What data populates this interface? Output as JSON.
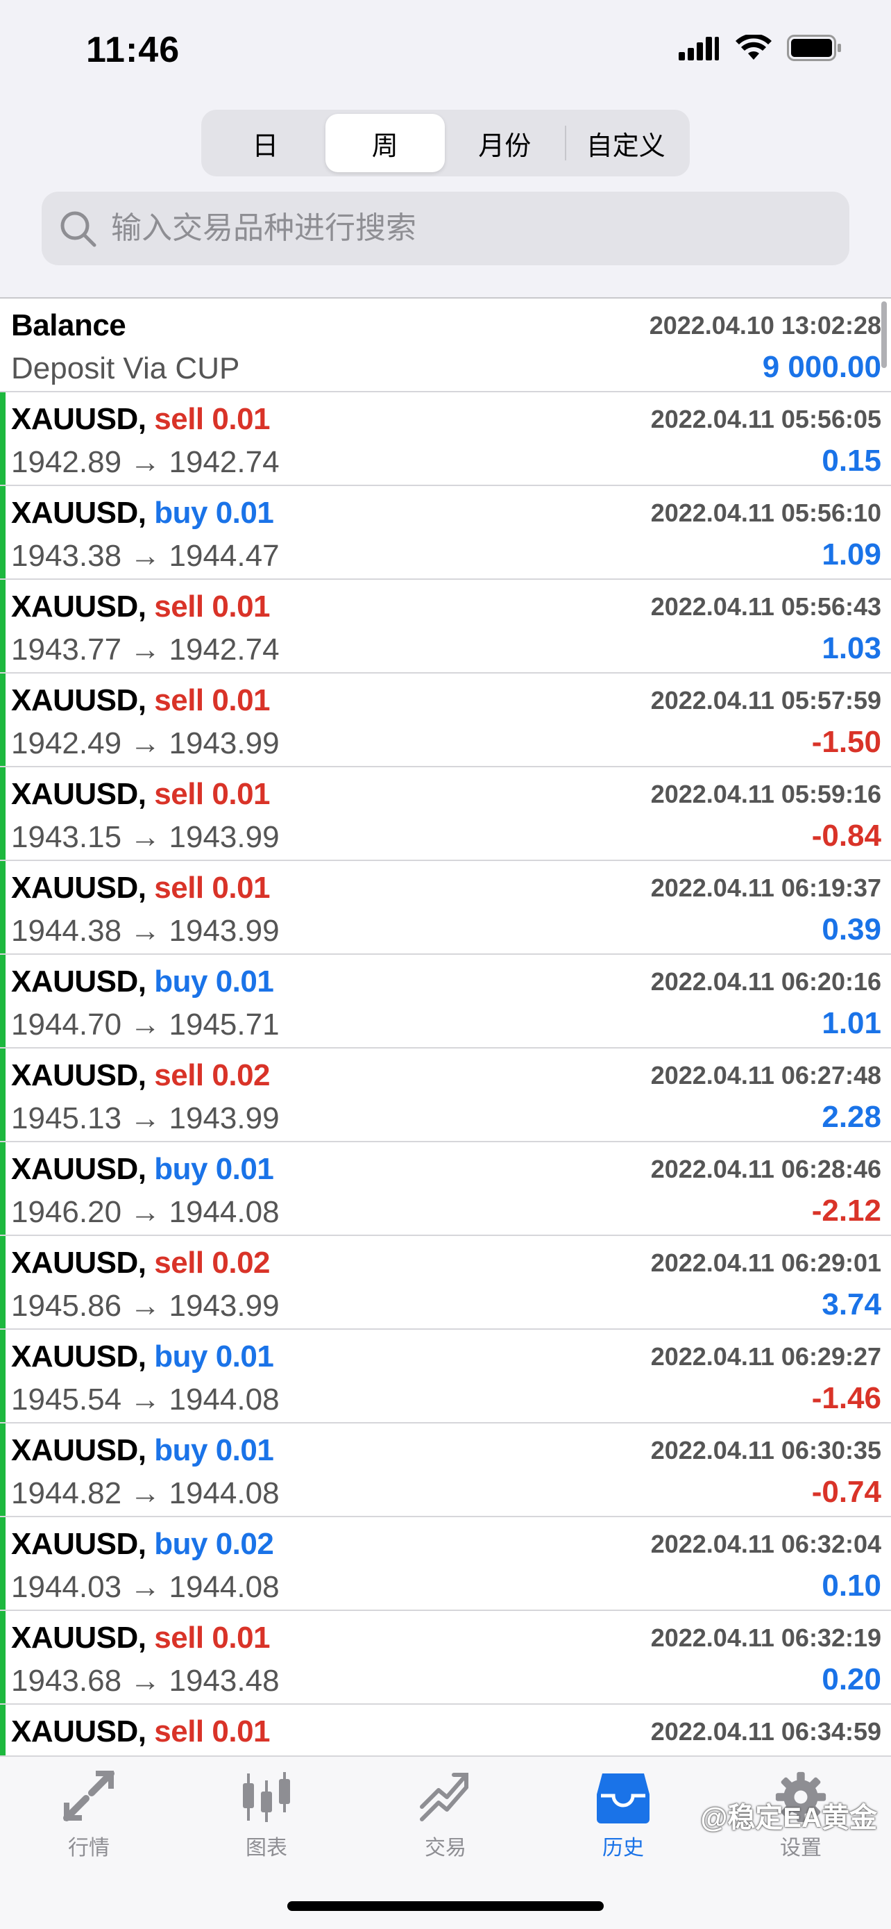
{
  "status": {
    "time": "11:46"
  },
  "tabs_period": [
    {
      "label": "日",
      "active": false
    },
    {
      "label": "周",
      "active": true
    },
    {
      "label": "月份",
      "active": false
    },
    {
      "label": "自定义",
      "active": false
    }
  ],
  "search": {
    "placeholder": "输入交易品种进行搜索"
  },
  "balance": {
    "title": "Balance",
    "subtitle": "Deposit Via CUP",
    "time": "2022.04.10 13:02:28",
    "amount": "9 000.00"
  },
  "trades": [
    {
      "symbol": "XAUUSD,",
      "side": "sell 0.01",
      "type": "sell",
      "time": "2022.04.11 05:56:05",
      "prices": "1942.89 → 1942.74",
      "profit": "0.15",
      "neg": false
    },
    {
      "symbol": "XAUUSD,",
      "side": "buy 0.01",
      "type": "buy",
      "time": "2022.04.11 05:56:10",
      "prices": "1943.38 → 1944.47",
      "profit": "1.09",
      "neg": false
    },
    {
      "symbol": "XAUUSD,",
      "side": "sell 0.01",
      "type": "sell",
      "time": "2022.04.11 05:56:43",
      "prices": "1943.77 → 1942.74",
      "profit": "1.03",
      "neg": false
    },
    {
      "symbol": "XAUUSD,",
      "side": "sell 0.01",
      "type": "sell",
      "time": "2022.04.11 05:57:59",
      "prices": "1942.49 → 1943.99",
      "profit": "-1.50",
      "neg": true
    },
    {
      "symbol": "XAUUSD,",
      "side": "sell 0.01",
      "type": "sell",
      "time": "2022.04.11 05:59:16",
      "prices": "1943.15 → 1943.99",
      "profit": "-0.84",
      "neg": true
    },
    {
      "symbol": "XAUUSD,",
      "side": "sell 0.01",
      "type": "sell",
      "time": "2022.04.11 06:19:37",
      "prices": "1944.38 → 1943.99",
      "profit": "0.39",
      "neg": false
    },
    {
      "symbol": "XAUUSD,",
      "side": "buy 0.01",
      "type": "buy",
      "time": "2022.04.11 06:20:16",
      "prices": "1944.70 → 1945.71",
      "profit": "1.01",
      "neg": false
    },
    {
      "symbol": "XAUUSD,",
      "side": "sell 0.02",
      "type": "sell",
      "time": "2022.04.11 06:27:48",
      "prices": "1945.13 → 1943.99",
      "profit": "2.28",
      "neg": false
    },
    {
      "symbol": "XAUUSD,",
      "side": "buy 0.01",
      "type": "buy",
      "time": "2022.04.11 06:28:46",
      "prices": "1946.20 → 1944.08",
      "profit": "-2.12",
      "neg": true
    },
    {
      "symbol": "XAUUSD,",
      "side": "sell 0.02",
      "type": "sell",
      "time": "2022.04.11 06:29:01",
      "prices": "1945.86 → 1943.99",
      "profit": "3.74",
      "neg": false
    },
    {
      "symbol": "XAUUSD,",
      "side": "buy 0.01",
      "type": "buy",
      "time": "2022.04.11 06:29:27",
      "prices": "1945.54 → 1944.08",
      "profit": "-1.46",
      "neg": true
    },
    {
      "symbol": "XAUUSD,",
      "side": "buy 0.01",
      "type": "buy",
      "time": "2022.04.11 06:30:35",
      "prices": "1944.82 → 1944.08",
      "profit": "-0.74",
      "neg": true
    },
    {
      "symbol": "XAUUSD,",
      "side": "buy 0.02",
      "type": "buy",
      "time": "2022.04.11 06:32:04",
      "prices": "1944.03 → 1944.08",
      "profit": "0.10",
      "neg": false
    },
    {
      "symbol": "XAUUSD,",
      "side": "sell 0.01",
      "type": "sell",
      "time": "2022.04.11 06:32:19",
      "prices": "1943.68 → 1943.48",
      "profit": "0.20",
      "neg": false
    },
    {
      "symbol": "XAUUSD,",
      "side": "sell 0.01",
      "type": "sell",
      "time": "2022.04.11 06:34:59",
      "prices": "",
      "profit": "",
      "neg": false
    }
  ],
  "tabbar": [
    {
      "label": "行情",
      "icon": "quotes-icon",
      "active": false
    },
    {
      "label": "图表",
      "icon": "chart-icon",
      "active": false
    },
    {
      "label": "交易",
      "icon": "trade-icon",
      "active": false
    },
    {
      "label": "历史",
      "icon": "history-icon",
      "active": true
    },
    {
      "label": "设置",
      "icon": "settings-icon",
      "active": false
    }
  ],
  "watermark": "@稳定EA黄金",
  "colors": {
    "sell": "#d93328",
    "buy": "#1a73e8",
    "accent": "#1a73e8",
    "bar": "#1db83e"
  }
}
